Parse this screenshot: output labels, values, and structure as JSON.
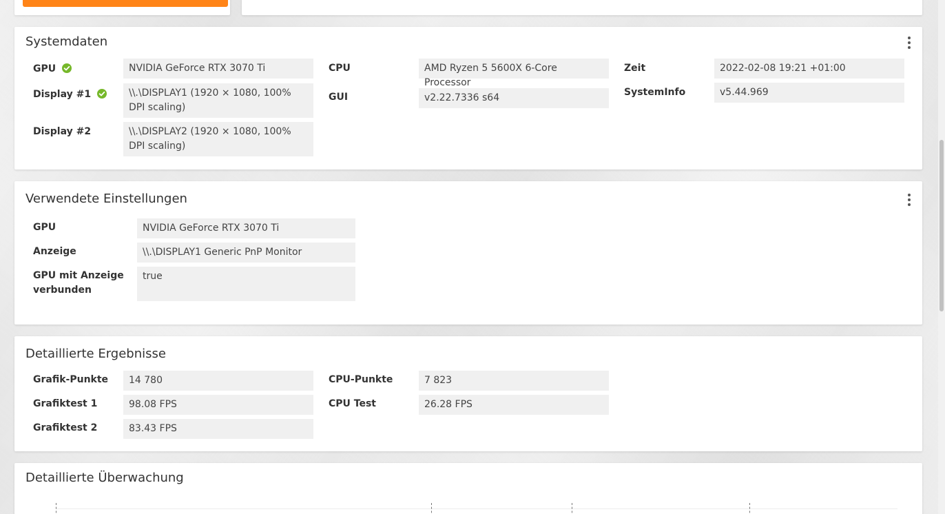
{
  "systemdaten": {
    "title": "Systemdaten",
    "gpu_label": "GPU",
    "gpu_value": "NVIDIA GeForce RTX 3070 Ti",
    "display1_label": "Display #1",
    "display1_value": "\\\\.\\DISPLAY1 (1920 × 1080, 100% DPI scaling)",
    "display2_label": "Display #2",
    "display2_value": "\\\\.\\DISPLAY2 (1920 × 1080, 100% DPI scaling)",
    "cpu_label": "CPU",
    "cpu_value": "AMD Ryzen 5 5600X 6-Core Processor",
    "gui_label": "GUI",
    "gui_value": "v2.22.7336 s64",
    "zeit_label": "Zeit",
    "zeit_value": "2022-02-08 19:21 +01:00",
    "systeminfo_label": "SystemInfo",
    "systeminfo_value": "v5.44.969"
  },
  "einstellungen": {
    "title": "Verwendete Einstellungen",
    "gpu_label": "GPU",
    "gpu_value": "NVIDIA GeForce RTX 3070 Ti",
    "anzeige_label": "Anzeige",
    "anzeige_value": "\\\\.\\DISPLAY1 Generic PnP Monitor",
    "verbunden_label": "GPU mit Anzeige verbunden",
    "verbunden_value": "true"
  },
  "ergebnisse": {
    "title": "Detaillierte Ergebnisse",
    "grafik_punkte_label": "Grafik-Punkte",
    "grafik_punkte_value": "14 780",
    "grafiktest1_label": "Grafiktest 1",
    "grafiktest1_value": "98.08 FPS",
    "grafiktest2_label": "Grafiktest 2",
    "grafiktest2_value": "83.43 FPS",
    "cpu_punkte_label": "CPU-Punkte",
    "cpu_punkte_value": "7 823",
    "cpu_test_label": "CPU Test",
    "cpu_test_value": "26.28 FPS"
  },
  "ueberwachung": {
    "title": "Detaillierte Überwachung"
  },
  "colors": {
    "accent_orange": "#ff8418",
    "check_green": "#76b82a",
    "panel_bg": "#ffffff",
    "value_bg": "#f0f0f0"
  },
  "icons": {
    "status_ok": "check-circle-icon",
    "menu": "kebab-menu-icon"
  }
}
